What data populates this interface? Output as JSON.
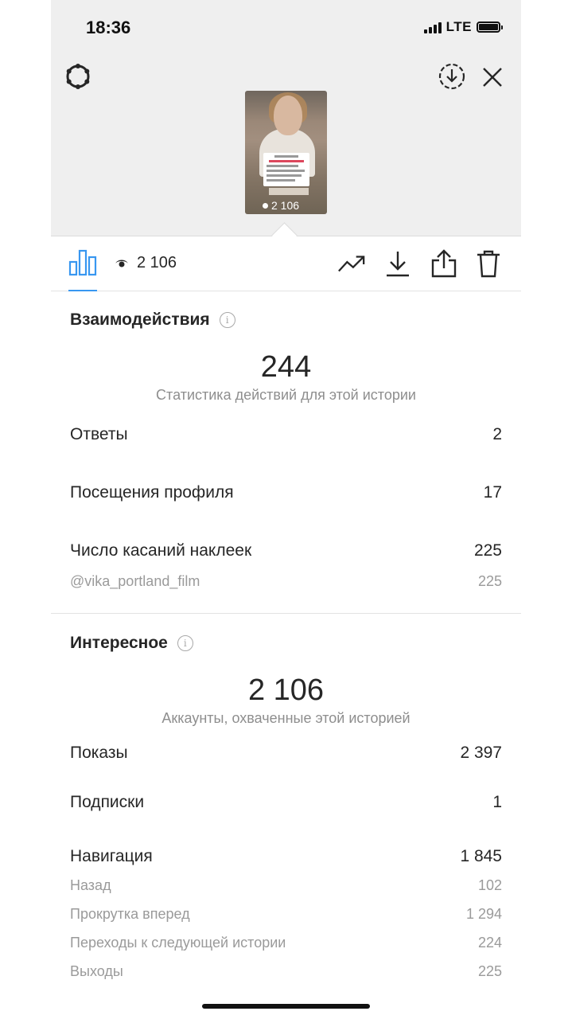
{
  "status_bar": {
    "time": "18:36",
    "network": "LTE"
  },
  "icons": {
    "settings": "settings-ring-icon",
    "save_story": "download-circle-icon",
    "close": "close-icon",
    "insights_tab": "bar-chart-icon",
    "views": "eye-icon",
    "promote": "trending-up-icon",
    "save": "download-icon",
    "share": "share-icon",
    "delete": "trash-icon"
  },
  "story": {
    "thumbnail_views": "2 106"
  },
  "toolbar": {
    "views_count": "2 106"
  },
  "interactions": {
    "title": "Взаимодействия",
    "total": "244",
    "caption": "Статистика действий для этой истории",
    "rows": [
      {
        "label": "Ответы",
        "value": "2"
      },
      {
        "label": "Посещения профиля",
        "value": "17"
      },
      {
        "label": "Число касаний наклеек",
        "value": "225"
      }
    ],
    "sticker_rows": [
      {
        "label": "@vika_portland_film",
        "value": "225"
      }
    ]
  },
  "discovery": {
    "title": "Интересное",
    "total": "2 106",
    "caption": "Аккаунты, охваченные этой историей",
    "rows": [
      {
        "label": "Показы",
        "value": "2 397"
      },
      {
        "label": "Подписки",
        "value": "1"
      },
      {
        "label": "Навигация",
        "value": "1 845"
      }
    ],
    "navigation_rows": [
      {
        "label": "Назад",
        "value": "102"
      },
      {
        "label": "Прокрутка вперед",
        "value": "1 294"
      },
      {
        "label": "Переходы к следующей истории",
        "value": "224"
      },
      {
        "label": "Выходы",
        "value": "225"
      }
    ]
  },
  "colors": {
    "accent": "#3897f0",
    "text_primary": "#262626",
    "text_secondary": "#8e8e8e",
    "header_bg": "#efefef"
  }
}
